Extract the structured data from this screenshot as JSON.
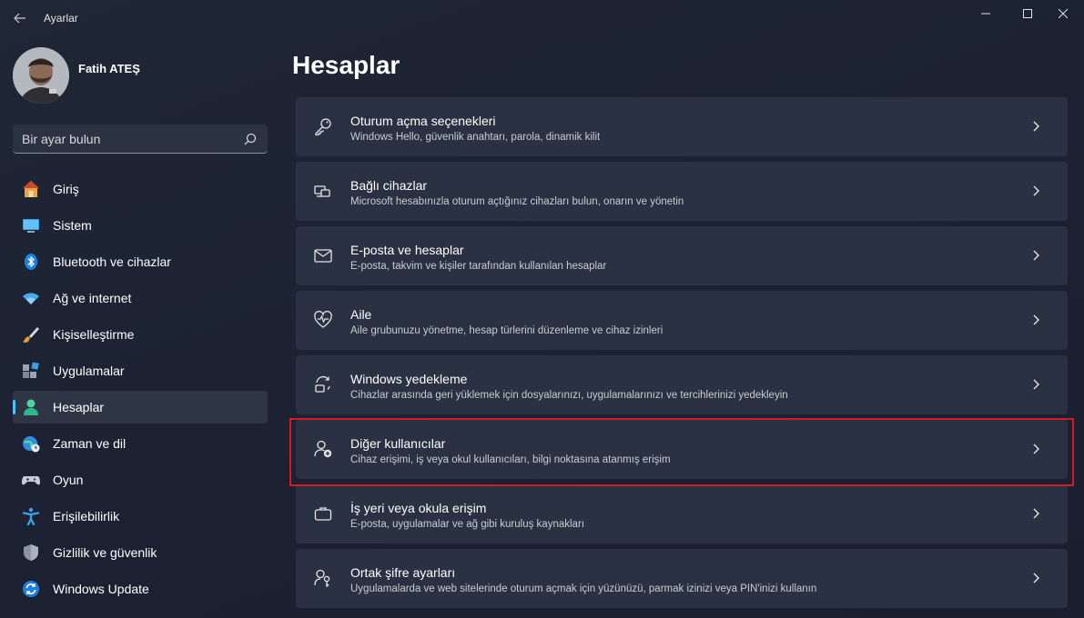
{
  "window": {
    "title": "Ayarlar"
  },
  "profile": {
    "name": "Fatih ATEŞ"
  },
  "search": {
    "placeholder": "Bir ayar bulun"
  },
  "nav": {
    "items": [
      {
        "label": "Giriş",
        "icon": "home-icon"
      },
      {
        "label": "Sistem",
        "icon": "monitor-icon"
      },
      {
        "label": "Bluetooth ve cihazlar",
        "icon": "bluetooth-icon"
      },
      {
        "label": "Ağ ve internet",
        "icon": "wifi-icon"
      },
      {
        "label": "Kişiselleştirme",
        "icon": "brush-icon"
      },
      {
        "label": "Uygulamalar",
        "icon": "apps-icon"
      },
      {
        "label": "Hesaplar",
        "icon": "person-icon",
        "active": true
      },
      {
        "label": "Zaman ve dil",
        "icon": "globe-clock-icon"
      },
      {
        "label": "Oyun",
        "icon": "gamepad-icon"
      },
      {
        "label": "Erişilebilirlik",
        "icon": "accessibility-icon"
      },
      {
        "label": "Gizlilik ve güvenlik",
        "icon": "shield-icon"
      },
      {
        "label": "Windows Update",
        "icon": "update-icon"
      }
    ]
  },
  "main": {
    "title": "Hesaplar",
    "cards": [
      {
        "title": "Oturum açma seçenekleri",
        "desc": "Windows Hello, güvenlik anahtarı, parola, dinamik kilit",
        "icon": "key-icon"
      },
      {
        "title": "Bağlı cihazlar",
        "desc": "Microsoft hesabınızla oturum açtığınız cihazları bulun, onarın ve yönetin",
        "icon": "devices-icon"
      },
      {
        "title": "E-posta ve hesaplar",
        "desc": "E-posta, takvim ve kişiler tarafından kullanılan hesaplar",
        "icon": "mail-icon"
      },
      {
        "title": "Aile",
        "desc": "Aile grubunuzu yönetme, hesap türlerini düzenleme ve cihaz izinleri",
        "icon": "family-heart-icon"
      },
      {
        "title": "Windows yedekleme",
        "desc": "Cihazlar arasında geri yüklemek için dosyalarınızı, uygulamalarınızı ve tercihlerinizi yedekleyin",
        "icon": "backup-icon"
      },
      {
        "title": "Diğer kullanıcılar",
        "desc": "Cihaz erişimi, iş veya okul kullanıcıları, bilgi noktasına atanmış erişim",
        "icon": "add-user-icon",
        "highlighted": true
      },
      {
        "title": "İş yeri veya okula erişim",
        "desc": "E-posta, uygulamalar ve ağ gibi kuruluş kaynakları",
        "icon": "briefcase-icon"
      },
      {
        "title": "Ortak şifre ayarları",
        "desc": "Uygulamalarda ve web sitelerinde oturum açmak için yüzünüzü, parmak izinizi veya PIN'inizi kullanın",
        "icon": "passkey-icon"
      }
    ]
  },
  "colors": {
    "accent": "#4cc2ff",
    "highlight_border": "#d71920"
  }
}
